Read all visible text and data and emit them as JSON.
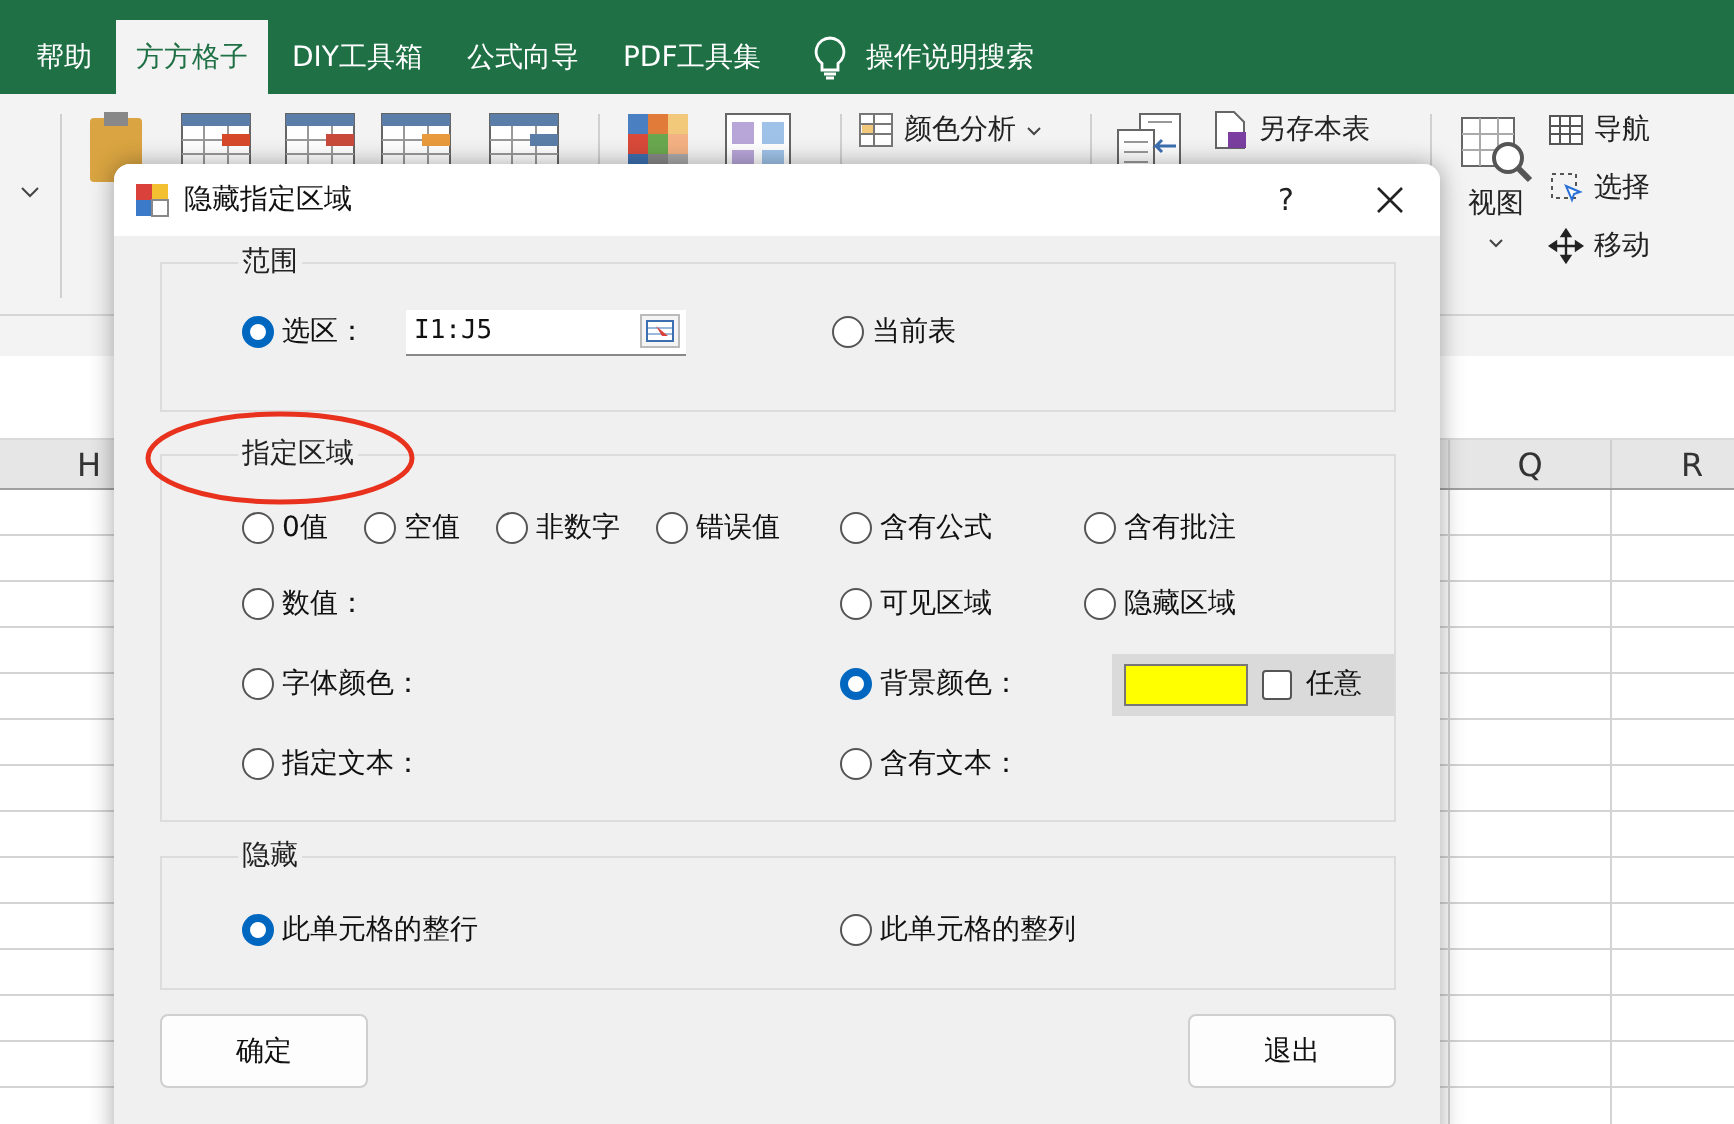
{
  "ribbon_tabs": [
    {
      "label": "帮助",
      "selected": false
    },
    {
      "label": "方方格子",
      "selected": true
    },
    {
      "label": "DIY工具箱",
      "selected": false
    },
    {
      "label": "公式向导",
      "selected": false
    },
    {
      "label": "PDF工具集",
      "selected": false
    }
  ],
  "tell_me": "操作说明搜索",
  "ribbon": {
    "color_analysis": "颜色分析",
    "save_sheet": "另存本表",
    "view": "视图",
    "side_commands": [
      "导航",
      "选择",
      "移动"
    ]
  },
  "columns_left": [
    "H"
  ],
  "columns_right": [
    "Q",
    "R"
  ],
  "dialog": {
    "title": "隐藏指定区域",
    "help": "?",
    "scope": {
      "label": "范围",
      "options": [
        {
          "label": "选区：",
          "selected": true
        },
        {
          "label": "当前表",
          "selected": false
        }
      ],
      "range_value": "I1:J5"
    },
    "area": {
      "label": "指定区域",
      "rows": [
        {
          "left": [
            {
              "label": "0值",
              "selected": false
            },
            {
              "label": "空值",
              "selected": false
            },
            {
              "label": "非数字",
              "selected": false
            },
            {
              "label": "错误值",
              "selected": false
            }
          ],
          "right": [
            {
              "label": "含有公式",
              "selected": false
            },
            {
              "label": "含有批注",
              "selected": false
            }
          ]
        },
        {
          "left": [
            {
              "label": "数值：",
              "selected": false
            }
          ],
          "right": [
            {
              "label": "可见区域",
              "selected": false
            },
            {
              "label": "隐藏区域",
              "selected": false
            }
          ]
        },
        {
          "left": [
            {
              "label": "字体颜色：",
              "selected": false
            }
          ],
          "right": [
            {
              "label": "背景颜色：",
              "selected": true
            }
          ],
          "swatch": {
            "color": "#ffff00",
            "any_label": "任意",
            "any_checked": false
          }
        },
        {
          "left": [
            {
              "label": "指定文本：",
              "selected": false
            }
          ],
          "right": [
            {
              "label": "含有文本：",
              "selected": false
            }
          ]
        }
      ]
    },
    "hide": {
      "label": "隐藏",
      "options": [
        {
          "label": "此单元格的整行",
          "selected": true
        },
        {
          "label": "此单元格的整列",
          "selected": false
        }
      ]
    },
    "buttons": [
      "确定",
      "退出"
    ]
  }
}
